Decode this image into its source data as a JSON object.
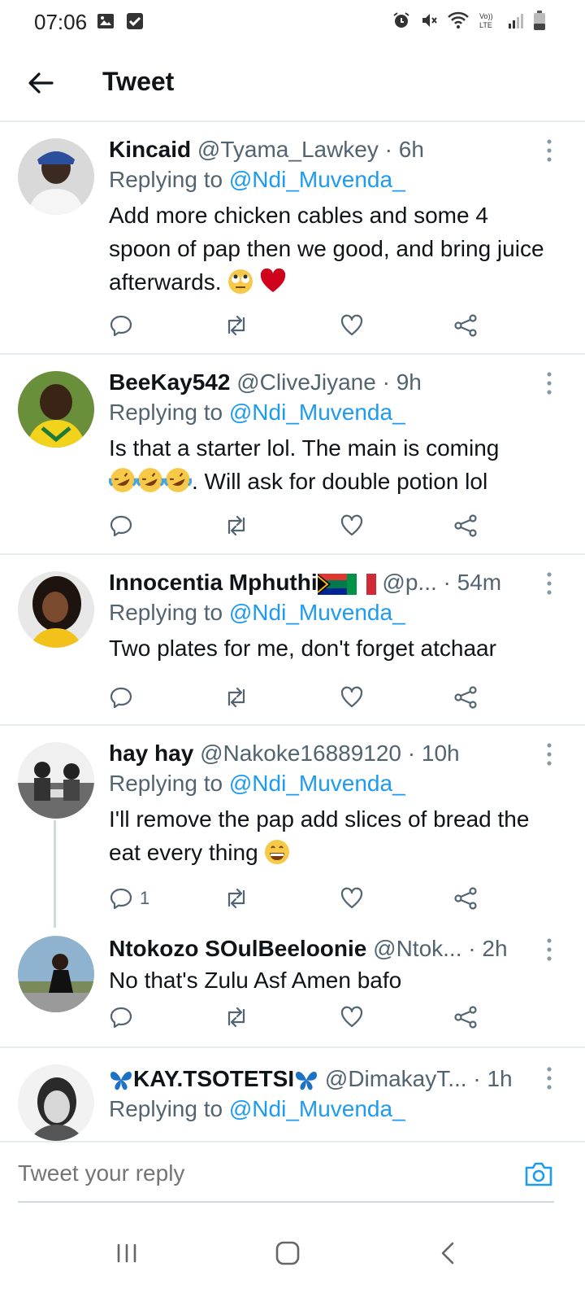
{
  "status_bar": {
    "time": "07:06",
    "left_icons": [
      "image-icon",
      "checkbox-icon"
    ],
    "right_icons": [
      "alarm-icon",
      "mute-icon",
      "wifi-icon",
      "volte-icon",
      "signal-icon",
      "battery-icon"
    ],
    "volte_text_top": "Vo))",
    "volte_text_bottom": "LTE"
  },
  "header": {
    "title": "Tweet",
    "back_icon": "arrow-left-icon"
  },
  "colors": {
    "accent": "#1d9bf0",
    "secondary_text": "#536471",
    "divider": "#e6ecf0"
  },
  "tweets": [
    {
      "name": "Kincaid",
      "handle": "@Tyama_Lawkey",
      "time": "· 6h",
      "reply_prefix": "Replying to",
      "reply_to": "@Ndi_Muvenda_",
      "text": "Add more chicken cables and some 4 spoon of pap then we good, and bring juice afterwards.",
      "emojis": [
        "rolling-eyes-emoji",
        "red-heart-emoji"
      ],
      "reply_count": ""
    },
    {
      "name": "BeeKay542",
      "handle": "@CliveJiyane",
      "time": "· 9h",
      "reply_prefix": "Replying to",
      "reply_to": "@Ndi_Muvenda_",
      "text_a": "Is that a starter lol. The main is coming",
      "text_b": ". Will ask for double potion lol",
      "emojis": [
        "rofl-emoji",
        "rofl-emoji",
        "rofl-emoji"
      ],
      "reply_count": ""
    },
    {
      "name": "Innocentia Mphuthi",
      "handle": "@p...",
      "time": "· 54m",
      "flags": [
        "south-africa-flag-emoji",
        "italy-flag-emoji"
      ],
      "reply_prefix": "Replying to",
      "reply_to": "@Ndi_Muvenda_",
      "text": "Two plates for me, don't forget atchaar",
      "reply_count": ""
    },
    {
      "name": "hay hay",
      "handle": "@Nakoke16889120",
      "time": "· 10h",
      "reply_prefix": "Replying to",
      "reply_to": "@Ndi_Muvenda_",
      "text": "I'll remove the pap add slices of bread the eat every thing",
      "emojis": [
        "grinning-emoji"
      ],
      "reply_count": "1"
    },
    {
      "name": "Ntokozo SOulBeeloonie",
      "handle": "@Ntok...",
      "time": "· 2h",
      "text": "No that's Zulu Asf Amen bafo",
      "reply_count": ""
    },
    {
      "name": "KAY.TSOTETSI",
      "name_emojis": [
        "butterfly-emoji",
        "butterfly-emoji"
      ],
      "handle": "@DimakayT...",
      "time": "· 1h",
      "reply_prefix": "Replying to",
      "reply_to": "@Ndi_Muvenda_"
    }
  ],
  "compose": {
    "placeholder": "Tweet your reply",
    "camera_icon": "camera-icon"
  },
  "nav": [
    "recents-icon",
    "home-icon",
    "back-icon"
  ]
}
